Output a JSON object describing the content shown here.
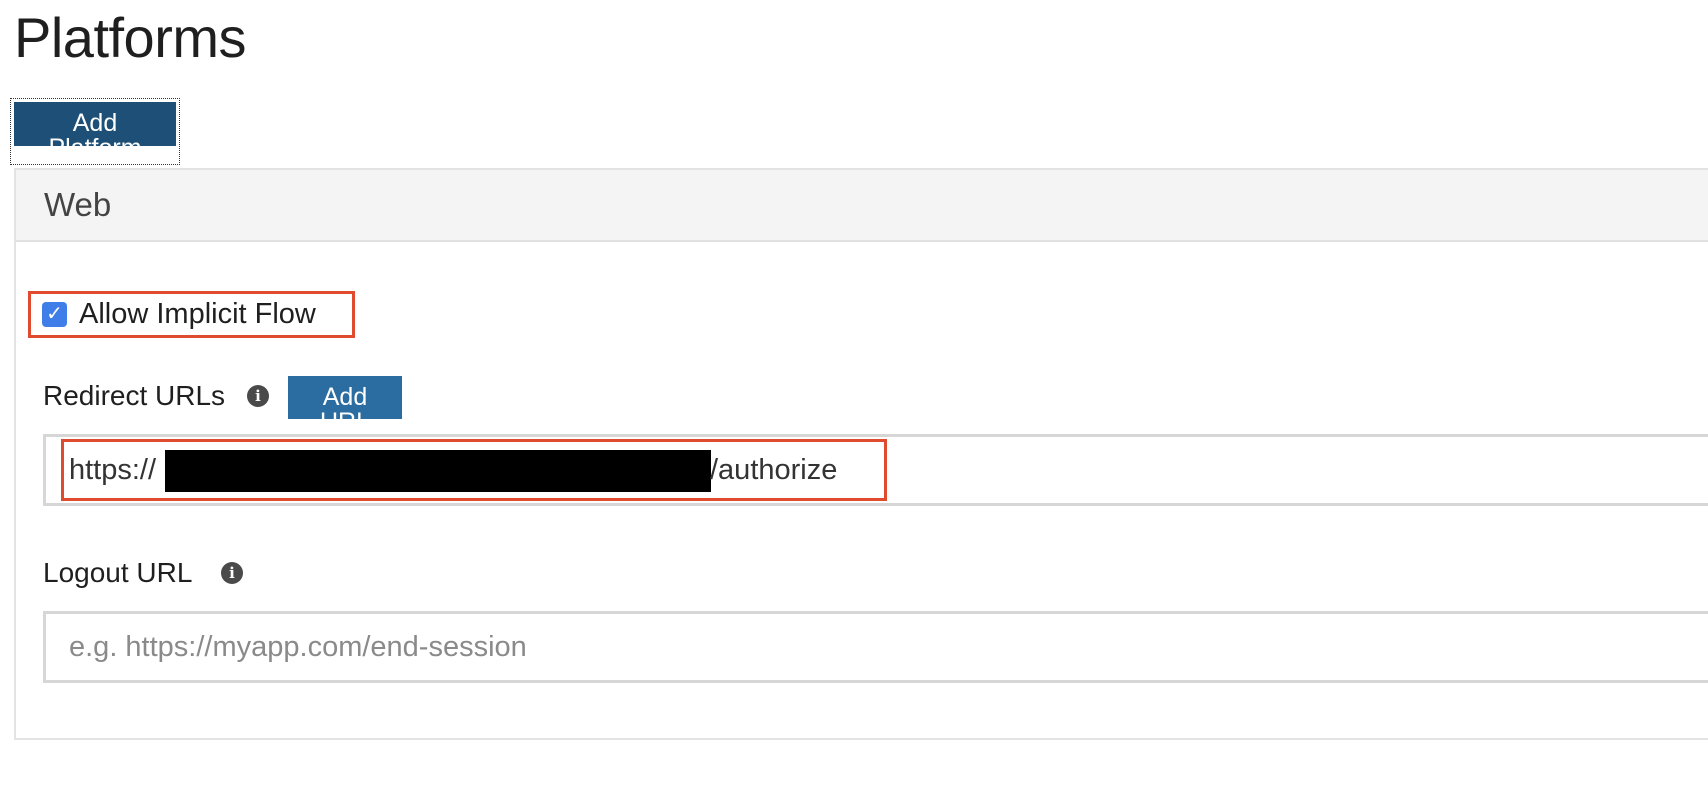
{
  "page": {
    "title": "Platforms"
  },
  "toolbar": {
    "add_platform_label": "Add Platform"
  },
  "web_panel": {
    "header": "Web",
    "allow_implicit_flow": {
      "label": "Allow Implicit Flow",
      "checked": true,
      "check_glyph": "✓"
    },
    "redirect_urls": {
      "label": "Redirect URLs",
      "info_icon": "i",
      "add_url_label": "Add URL",
      "value_prefix": "https://",
      "value_suffix": "/authorize"
    },
    "logout_url": {
      "label": "Logout URL",
      "info_icon": "i",
      "placeholder": "e.g. https://myapp.com/end-session"
    }
  },
  "colors": {
    "primary_button": "#1e5077",
    "secondary_button": "#2c6da1",
    "checkbox": "#3f7ee8",
    "highlight_box": "#e04a2f"
  }
}
